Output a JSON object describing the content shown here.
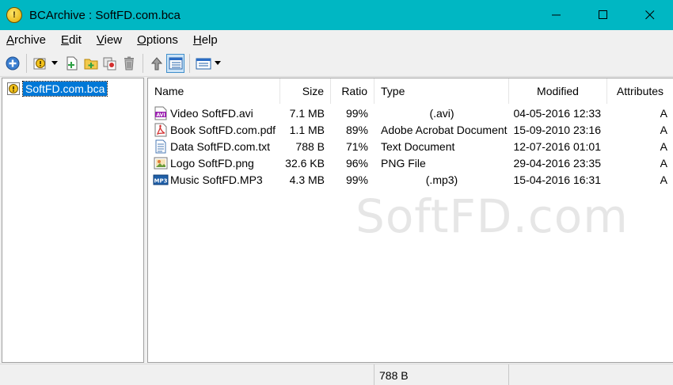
{
  "window": {
    "title": "BCArchive : SoftFD.com.bca",
    "icon": "bcarchive-icon"
  },
  "menu": [
    {
      "label": "Archive",
      "u": "A",
      "rest": "rchive"
    },
    {
      "label": "Edit",
      "u": "E",
      "rest": "dit"
    },
    {
      "label": "View",
      "u": "V",
      "rest": "iew"
    },
    {
      "label": "Options",
      "u": "O",
      "rest": "ptions"
    },
    {
      "label": "Help",
      "u": "H",
      "rest": "elp"
    }
  ],
  "toolbar": {
    "buttons": [
      "new-archive-icon",
      "open-archive-icon",
      "add-files-icon",
      "add-folder-icon",
      "extract-icon",
      "delete-icon",
      "up-folder-icon",
      "details-view-icon",
      "view-options-icon"
    ]
  },
  "tree": {
    "root_label": "SoftFD.com.bca"
  },
  "list": {
    "columns": {
      "name": "Name",
      "size": "Size",
      "ratio": "Ratio",
      "type": "Type",
      "modified": "Modified",
      "attributes": "Attributes"
    },
    "rows": [
      {
        "icon": "avi-file-icon",
        "name": "Video SoftFD.avi",
        "size": "7.1 MB",
        "ratio": "99%",
        "type": "(.avi)",
        "modified": "04-05-2016 12:33",
        "attributes": "A"
      },
      {
        "icon": "pdf-file-icon",
        "name": "Book SoftFD.com.pdf",
        "size": "1.1 MB",
        "ratio": "89%",
        "type": "Adobe Acrobat Document",
        "modified": "15-09-2010 23:16",
        "attributes": "A"
      },
      {
        "icon": "text-file-icon",
        "name": "Data SoftFD.com.txt",
        "size": "788 B",
        "ratio": "71%",
        "type": "Text Document",
        "modified": "12-07-2016 01:01",
        "attributes": "A"
      },
      {
        "icon": "png-file-icon",
        "name": "Logo SoftFD.png",
        "size": "32.6 KB",
        "ratio": "96%",
        "type": "PNG File",
        "modified": "29-04-2016 23:35",
        "attributes": "A"
      },
      {
        "icon": "mp3-file-icon",
        "name": "Music SoftFD.MP3",
        "size": "4.3 MB",
        "ratio": "99%",
        "type": "(.mp3)",
        "modified": "15-04-2016 16:31",
        "attributes": "A"
      }
    ]
  },
  "watermark": "SoftFD.com",
  "status": {
    "selected_size": "788 B"
  }
}
